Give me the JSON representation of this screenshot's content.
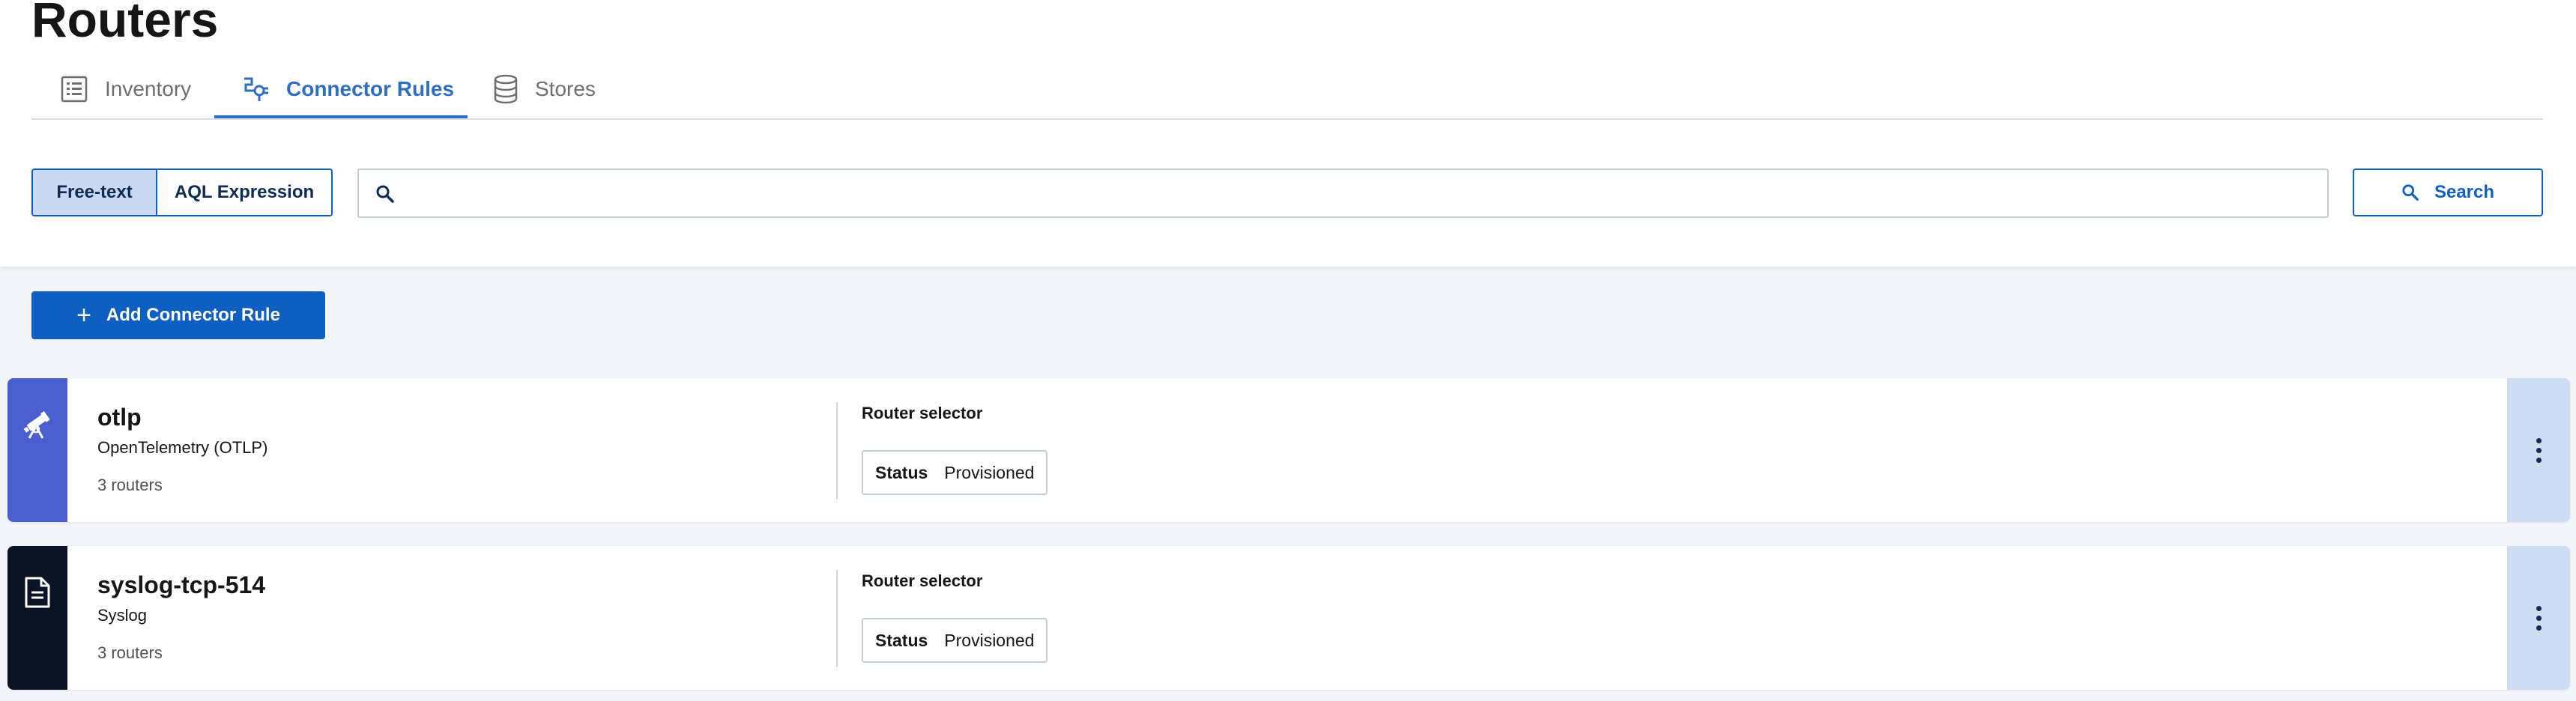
{
  "page": {
    "title": "Routers"
  },
  "tabs": [
    {
      "label": "Inventory",
      "icon": "list-icon",
      "active": false
    },
    {
      "label": "Connector Rules",
      "icon": "connector-plug-icon",
      "active": true
    },
    {
      "label": "Stores",
      "icon": "database-icon",
      "active": false
    }
  ],
  "search": {
    "modes": [
      "Free-text",
      "AQL Expression"
    ],
    "selected_mode": "Free-text",
    "value": "",
    "placeholder": "",
    "button_label": "Search"
  },
  "actions": {
    "add_label": "Add Connector Rule"
  },
  "rules": [
    {
      "name": "otlp",
      "type": "OpenTelemetry (OTLP)",
      "router_count": "3 routers",
      "selector_label": "Router selector",
      "status_key": "Status",
      "status_value": "Provisioned",
      "icon": "telescope-icon",
      "accent_color": "#4a5fcf"
    },
    {
      "name": "syslog-tcp-514",
      "type": "Syslog",
      "router_count": "3 routers",
      "selector_label": "Router selector",
      "status_key": "Status",
      "status_value": "Provisioned",
      "icon": "document-icon",
      "accent_color": "#0b1424"
    }
  ],
  "colors": {
    "primary": "#0f5fc2",
    "tab_active": "#2f6fc1",
    "menu_bg": "#cddcf1",
    "page_bg": "#f3f5fb"
  }
}
